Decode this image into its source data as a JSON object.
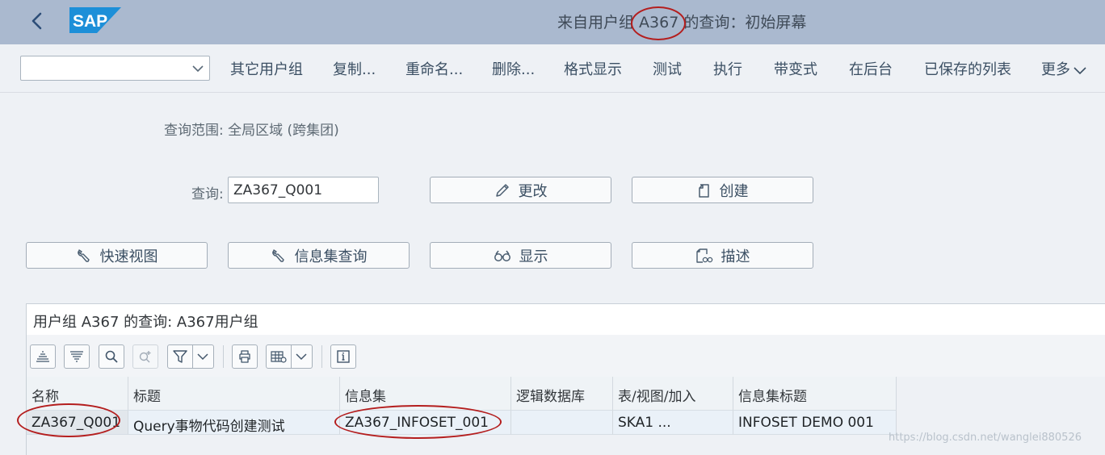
{
  "shell": {
    "title_prefix": "来自用户组 ",
    "title_highlight": "A367",
    "title_suffix": " 的查询：初始屏幕",
    "logo_text": "SAP"
  },
  "toolbar": {
    "variant_value": "",
    "items": [
      "其它用户组",
      "复制...",
      "重命名...",
      "删除...",
      "格式显示",
      "测试",
      "执行",
      "带变式",
      "在后台",
      "已保存的列表",
      "更多"
    ]
  },
  "form": {
    "scope_label": "查询范围: 全局区域 (跨集团)",
    "query_label": "查询:",
    "query_value": "ZA367_Q001",
    "change_label": "更改",
    "create_label": "创建",
    "quick_view_label": "快速视图",
    "infoset_query_label": "信息集查询",
    "display_label": "显示",
    "describe_label": "描述"
  },
  "table": {
    "title": "用户组 A367 的查询: A367用户组",
    "columns": [
      "名称",
      "标题",
      "信息集",
      "逻辑数据库",
      "表/视图/加入",
      "信息集标题"
    ],
    "rows": [
      [
        "ZA367_Q001",
        "Query事物代码创建测试",
        "ZA367_INFOSET_001",
        "",
        "SKA1 ...",
        "INFOSET DEMO 001"
      ]
    ]
  },
  "watermark": "https://blog.csdn.net/wanglei880526",
  "colors": {
    "shell_bg": "#aab9cf",
    "page_bg": "#eef1f5",
    "annotation_ring": "#b41e1e",
    "logo_blue": "#1d8fd8"
  },
  "icons": [
    "back-icon",
    "sap-logo",
    "chevron-down-icon",
    "pencil-icon",
    "document-icon",
    "wrench-icon",
    "glasses-icon",
    "describe-icon",
    "sort-ascending-icon",
    "sort-descending-icon",
    "search-icon",
    "search-next-icon",
    "filter-icon",
    "print-icon",
    "layout-icon",
    "info-icon"
  ]
}
